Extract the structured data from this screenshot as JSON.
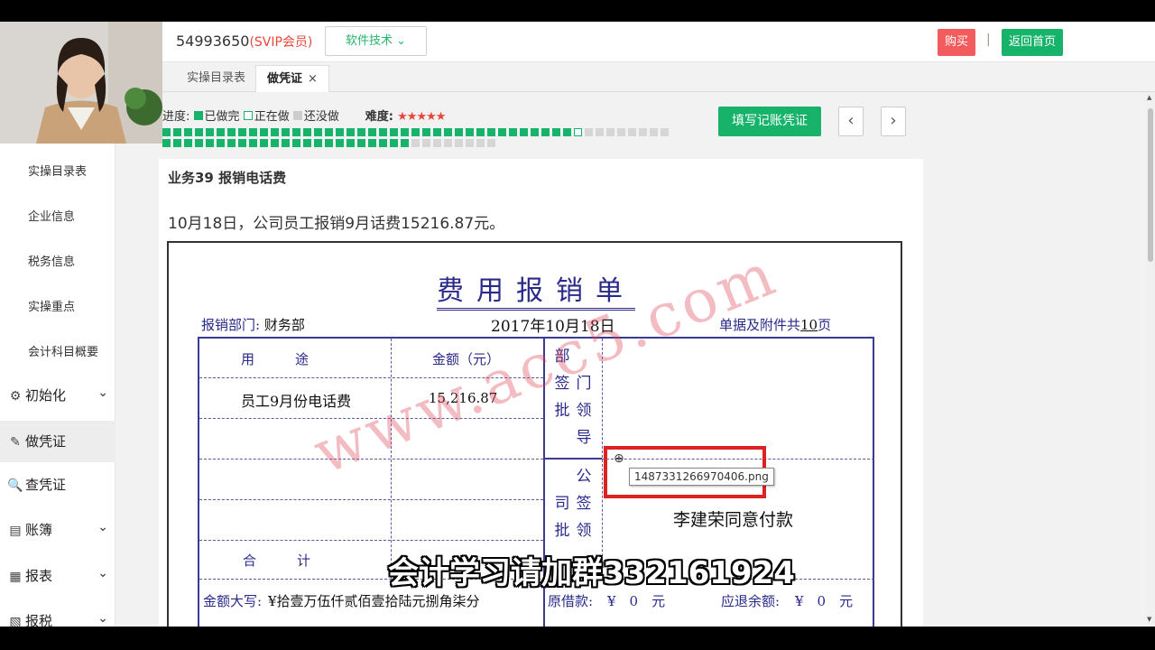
{
  "header": {
    "user_id": "54993650",
    "vip_label": "(SVIP会员)",
    "tech_button": "软件技术",
    "buy_button": "购买",
    "divider": "|",
    "home_button": "返回首页"
  },
  "tabs": [
    {
      "label": "实操目录表"
    },
    {
      "label": "做凭证",
      "close": "×"
    }
  ],
  "sidebar": {
    "sub_items": [
      "实操目录表",
      "企业信息",
      "税务信息",
      "实操重点",
      "会计科目概要"
    ],
    "main_items": [
      {
        "label": "初始化",
        "icon": "⚙",
        "chevron": "⌄"
      },
      {
        "label": "做凭证",
        "icon": "✎"
      },
      {
        "label": "查凭证",
        "icon": "🔍"
      },
      {
        "label": "账簿",
        "icon": "▤",
        "chevron": "⌄"
      },
      {
        "label": "报表",
        "icon": "▦",
        "chevron": "⌄"
      },
      {
        "label": "报税",
        "icon": "▧",
        "chevron": "⌄"
      }
    ]
  },
  "progress": {
    "label": "进度:",
    "done_label": "已做完",
    "doing_label": "正在做",
    "todo_label": "还没做",
    "difficulty_label": "难度:",
    "difficulty_stars": "★★★★★",
    "done_count": 38,
    "current_index": 38,
    "total": 63
  },
  "actions": {
    "fill_voucher": "填写记账凭证",
    "prev": "‹",
    "next": "›"
  },
  "business": {
    "title": "业务39 报销电话费",
    "description": "10月18日，公司员工报销9月话费15216.87元。"
  },
  "voucher": {
    "title": "费用报销单",
    "dept_label": "报销部门:",
    "dept_value": "财务部",
    "date": "2017年10月18日",
    "attach_prefix": "单据及附件共",
    "attach_count": "10",
    "attach_suffix": "页",
    "col_purpose": "用　　　途",
    "col_amount": "金额（元）",
    "dept_approve": [
      "部",
      "门",
      "签",
      "领",
      "批",
      "导"
    ],
    "company_approve": [
      "公",
      "司",
      "签",
      "领",
      "批"
    ],
    "row_purpose": "员工9月份电话费",
    "row_amount": "15,216.87",
    "total_label": "合　　　计",
    "approval_text": "李建荣同意付款",
    "amount_words_label": "金额大写:",
    "amount_words_value": "¥拾壹万伍仟贰佰壹拾陆元捌角柒分",
    "loan_label": "原借款:",
    "loan_value": "¥　0　元",
    "refund_label": "应退余额:",
    "refund_value": "¥　0　元",
    "watermark": "www.acc5.com"
  },
  "tooltip": "1487331266970406.png",
  "caption": "会计学习请加群332161924",
  "colors": {
    "accent_green": "#17b36b",
    "buy_red": "#f25c5c",
    "voucher_blue": "#2a2a8a"
  }
}
